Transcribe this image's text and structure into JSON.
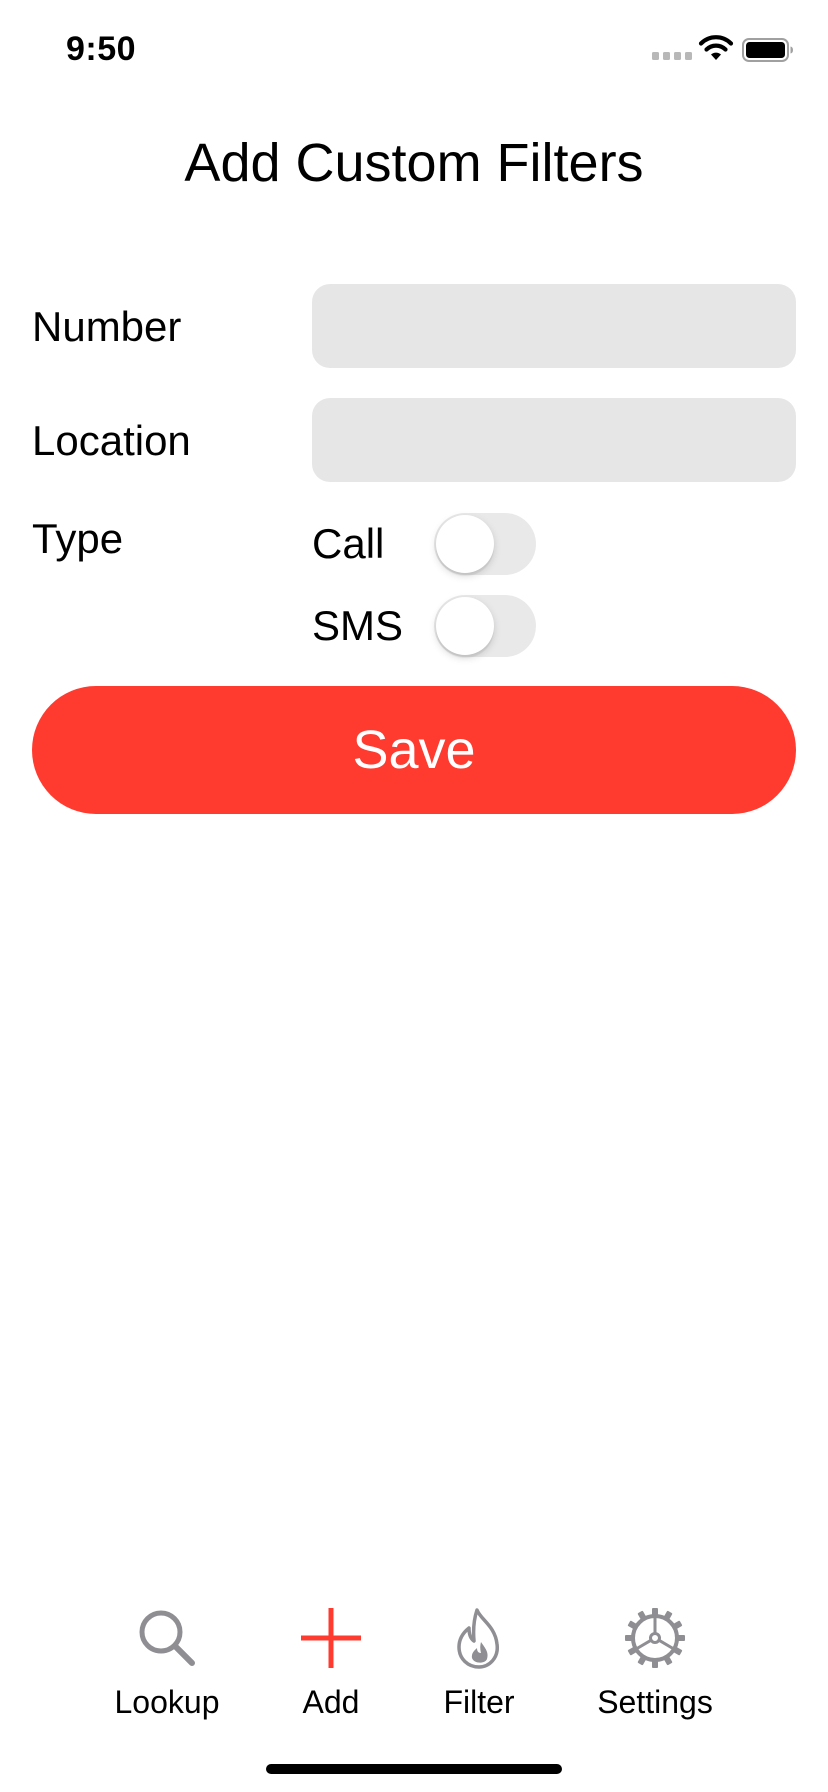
{
  "status_bar": {
    "time": "9:50",
    "wifi_icon": "wifi-icon",
    "battery_icon": "battery-icon"
  },
  "title": "Add Custom Filters",
  "form": {
    "number_label": "Number",
    "number_value": "",
    "location_label": "Location",
    "location_value": "",
    "type_label": "Type",
    "call_label": "Call",
    "call_enabled": false,
    "sms_label": "SMS",
    "sms_enabled": false
  },
  "save_label": "Save",
  "tab_bar": {
    "items": [
      {
        "label": "Lookup",
        "icon": "search-icon",
        "active": false
      },
      {
        "label": "Add",
        "icon": "plus-icon",
        "active": true
      },
      {
        "label": "Filter",
        "icon": "flame-icon",
        "active": false
      },
      {
        "label": "Settings",
        "icon": "gear-icon",
        "active": false
      }
    ]
  },
  "colors": {
    "accent": "#ff3b30",
    "input_background": "#e6e6e6",
    "switch_off": "#e9e9ea",
    "tab_inactive_icon": "#8e8e93"
  }
}
